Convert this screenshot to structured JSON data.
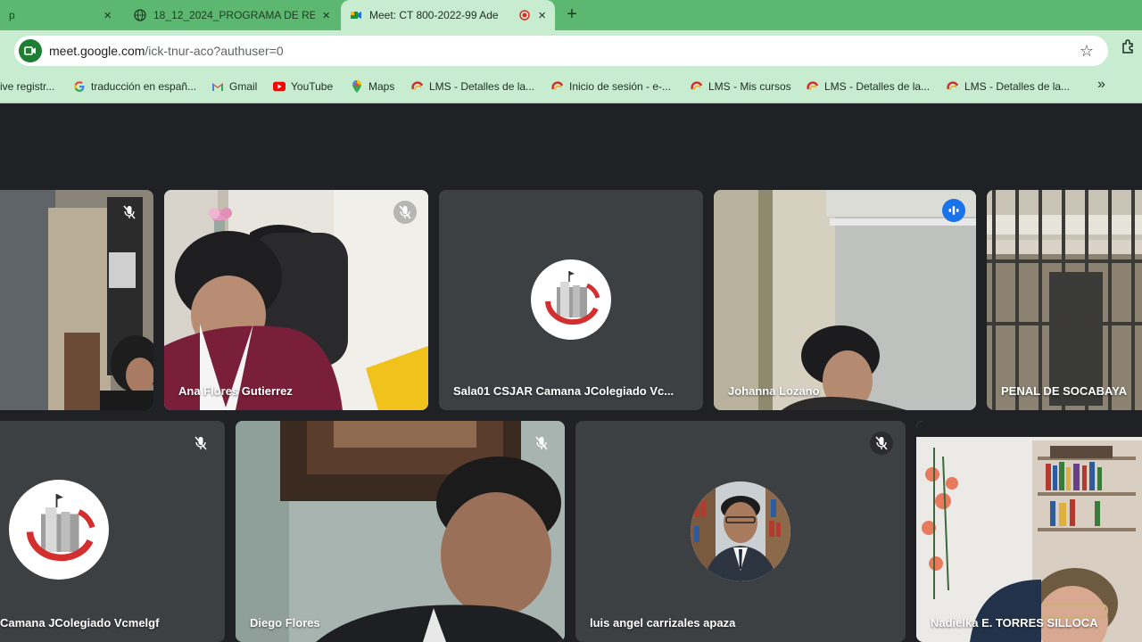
{
  "browser": {
    "tabs": [
      {
        "label": "p",
        "active": false
      },
      {
        "label": "18_12_2024_PROGRAMA DE RE",
        "active": false
      },
      {
        "label": "Meet: CT 800-2022-99 Ade",
        "active": true
      }
    ],
    "close_glyph": "×",
    "new_tab_glyph": "+",
    "url_host": "meet.google.com",
    "url_path": "/ick-tnur-aco?authuser=0",
    "star_glyph": "☆",
    "more_glyph": "»",
    "bookmarks": [
      {
        "label": "ive registr...",
        "icon": "generic-icon"
      },
      {
        "label": "traducción en españ...",
        "icon": "google-icon"
      },
      {
        "label": "Gmail",
        "icon": "gmail-icon"
      },
      {
        "label": "YouTube",
        "icon": "youtube-icon"
      },
      {
        "label": "Maps",
        "icon": "maps-icon"
      },
      {
        "label": "LMS - Detalles de la...",
        "icon": "lms-icon"
      },
      {
        "label": "Inicio de sesión - e-...",
        "icon": "lms-icon"
      },
      {
        "label": "LMS - Mis cursos",
        "icon": "lms-icon"
      },
      {
        "label": "LMS - Detalles de la...",
        "icon": "lms-icon"
      },
      {
        "label": "LMS - Detalles de la...",
        "icon": "lms-icon"
      }
    ]
  },
  "meet": {
    "participants": [
      {
        "name": "",
        "muted": true
      },
      {
        "name": "Ana Flores Gutierrez",
        "muted": true
      },
      {
        "name": "Sala01 CSJAR Camana JColegiado Vc...",
        "muted": false
      },
      {
        "name": "Johanna Lozano",
        "muted": false,
        "speaking": true
      },
      {
        "name": "PENAL DE SOCABAYA",
        "muted": false
      },
      {
        "name": "Camana JColegiado Vcmelgf",
        "muted": true
      },
      {
        "name": "Diego Flores",
        "muted": true
      },
      {
        "name": "luis angel carrizales apaza",
        "muted": true
      },
      {
        "name": "Nadielka E. TORRES SILLOCA",
        "muted": false
      }
    ]
  },
  "colors": {
    "tabstrip": "#5cb870",
    "toolbar": "#c8ecd0",
    "stage": "#202124",
    "tile": "#3c4043",
    "speaking_outline": "#4a90e2",
    "logo_red": "#d32f2f"
  }
}
